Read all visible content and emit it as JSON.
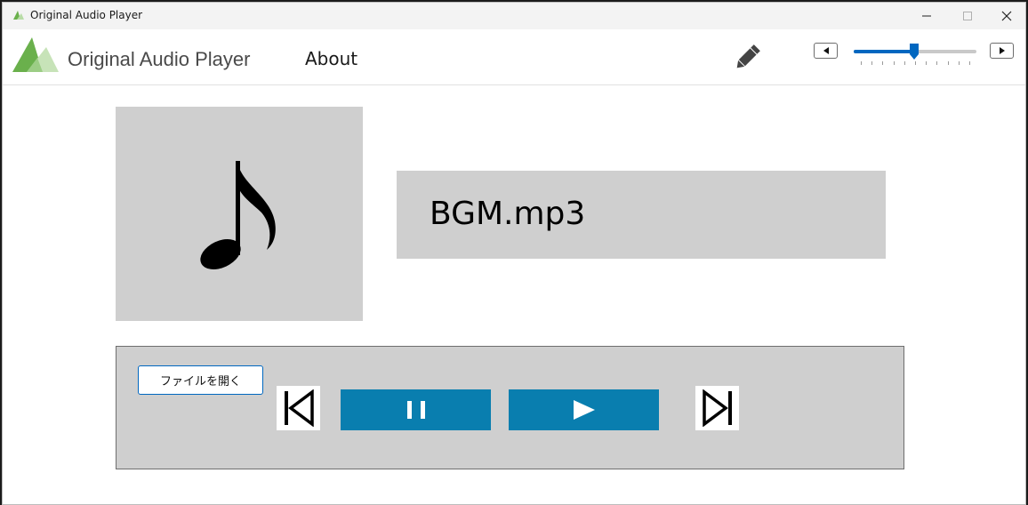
{
  "window": {
    "title": "Original Audio Player",
    "controls": {
      "minimize": "minimize-icon",
      "maximize": "maximize-icon",
      "close": "close-icon"
    }
  },
  "header": {
    "app_title": "Original Audio Player",
    "about_label": "About",
    "edit_icon": "pencil-icon",
    "volume": {
      "value_fraction": 0.49,
      "decrease_icon": "left-arrow-icon",
      "increase_icon": "right-arrow-icon",
      "ticks": 11
    }
  },
  "track": {
    "art_icon": "music-note-icon",
    "filename": "BGM.mp3"
  },
  "controls": {
    "open_file_label": "ファイルを開く",
    "previous_icon": "skip-previous-icon",
    "pause_icon": "pause-icon",
    "play_icon": "play-icon",
    "next_icon": "skip-next-icon"
  },
  "colors": {
    "accent": "#0067c0",
    "control_blue": "#097eaf",
    "panel_gray": "#cfcfcf",
    "logo_green": "#6ab04c"
  }
}
